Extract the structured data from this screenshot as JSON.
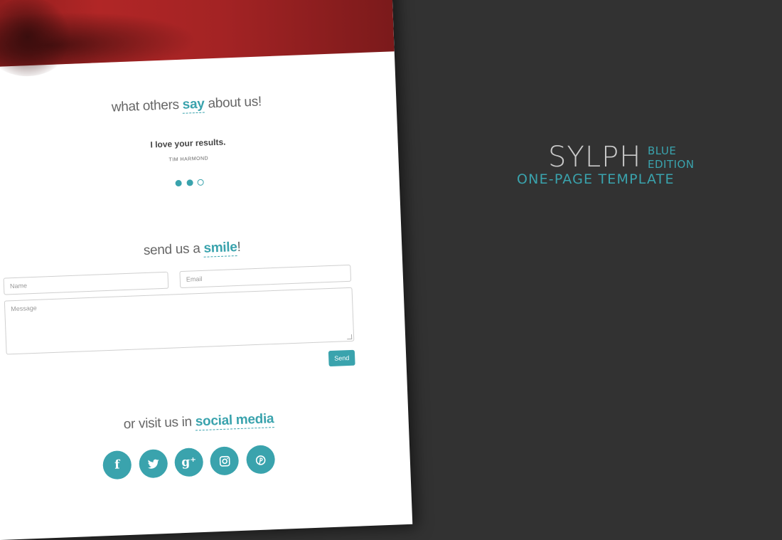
{
  "testimonials": {
    "heading_pre": "what others ",
    "heading_accent": "say",
    "heading_post": " about us!",
    "quote": "I love your results.",
    "author": "TIM HARMOND",
    "slides_total": 3,
    "slide_active": 3
  },
  "contact": {
    "heading_pre": "send us a ",
    "heading_accent": "smile",
    "heading_post": "!",
    "name_placeholder": "Name",
    "email_placeholder": "Email",
    "message_placeholder": "Message",
    "send_label": "Send"
  },
  "social": {
    "heading_pre": "or visit us in ",
    "heading_accent": "social media",
    "icons": [
      "facebook-icon",
      "twitter-icon",
      "google-plus-icon",
      "instagram-icon",
      "pinterest-icon"
    ]
  },
  "brand": {
    "name": "SYLPH",
    "edition_line1": "BLUE",
    "edition_line2": "EDITION",
    "tagline": "ONE-PAGE TEMPLATE"
  },
  "colors": {
    "accent": "#3aa3ad",
    "background": "#323232",
    "hero": "#a32324"
  }
}
